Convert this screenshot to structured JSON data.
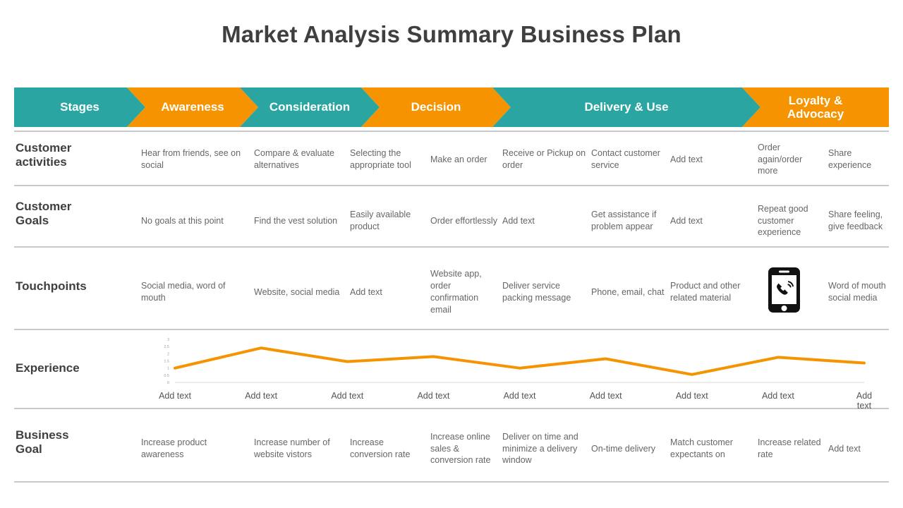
{
  "title": "Market Analysis Summary Business Plan",
  "colors": {
    "teal": "#2ba5a2",
    "orange": "#f59400",
    "line": "#f59400",
    "text": "#666666",
    "heading": "#3f3f3f"
  },
  "banner": {
    "stages": [
      {
        "label": "Stages",
        "color": "teal"
      },
      {
        "label": "Awareness",
        "color": "orange"
      },
      {
        "label": "Consideration",
        "color": "teal"
      },
      {
        "label": "Decision",
        "color": "orange"
      },
      {
        "label": "Delivery & Use",
        "color": "teal"
      },
      {
        "label": "Loyalty &\nAdvocacy",
        "color": "orange"
      }
    ]
  },
  "rows": [
    {
      "label": "Customer\nactivities",
      "cells": [
        "Hear from friends, see on social",
        "Compare & evaluate alternatives",
        "Selecting the appropriate tool",
        "Make an order",
        "Receive or Pickup on order",
        "Contact customer service",
        "Add text",
        "Order again/order more",
        "Share experience"
      ]
    },
    {
      "label": "Customer\nGoals",
      "cells": [
        "No goals at this point",
        "Find the vest solution",
        "Easily available product",
        "Order effortlessly",
        "Add text",
        "Get assistance if problem appear",
        "Add text",
        "Repeat good customer experience",
        "Share feeling, give feedback"
      ]
    },
    {
      "label": "Touchpoints",
      "cells": [
        "Social media, word of mouth",
        "Website, social media",
        "Add text",
        "Website app, order confirmation email",
        "Deliver service packing message",
        "Phone, email, chat",
        "Product and other related material",
        "",
        "Word of mouth social media"
      ],
      "icon_cell_index": 7,
      "icon": "mobile-phone-call-icon"
    },
    {
      "label": "Experience",
      "cells": []
    },
    {
      "label": "Business\nGoal",
      "cells": [
        "Increase product awareness",
        "Increase number of website vistors",
        "Increase conversion rate",
        "Increase online sales & conversion rate",
        "Deliver on time and minimize a delivery window",
        "On-time delivery",
        "Match customer expectants on",
        "Increase related rate",
        "Add text"
      ]
    }
  ],
  "chart_data": {
    "type": "line",
    "title": "Experience",
    "xlabel": "",
    "ylabel": "",
    "ylim": [
      0,
      3
    ],
    "yticks": [
      "0",
      "0.5",
      "1",
      "1.5",
      "2",
      "2.5",
      "3"
    ],
    "grid": false,
    "legend": "none",
    "categories": [
      "Add text",
      "Add text",
      "Add text",
      "Add text",
      "Add text",
      "Add text",
      "Add text",
      "Add text",
      "Add text"
    ],
    "series": [
      {
        "name": "Experience",
        "color": "#f59400",
        "values": [
          1.0,
          2.4,
          1.45,
          1.8,
          1.0,
          1.65,
          0.55,
          1.75,
          1.35
        ]
      }
    ]
  }
}
